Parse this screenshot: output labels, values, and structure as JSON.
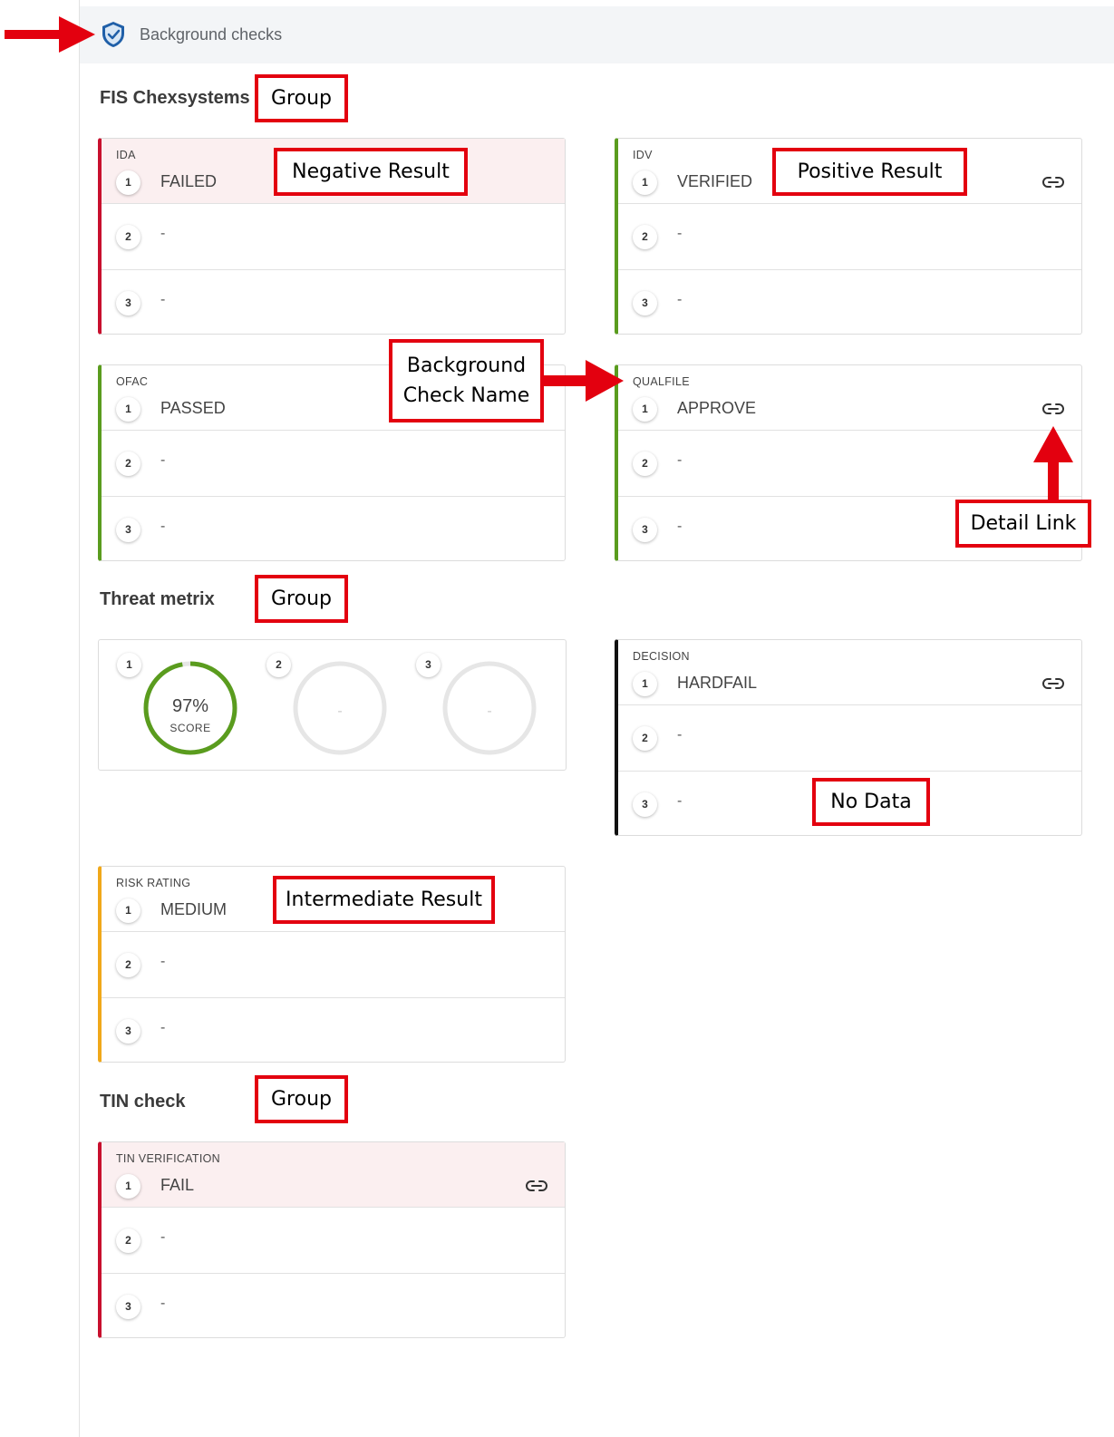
{
  "header": {
    "title": "Background checks"
  },
  "groups": {
    "fis": {
      "title": "FIS Chexsystems"
    },
    "threat": {
      "title": "Threat metrix"
    },
    "tin": {
      "title": "TIN check"
    }
  },
  "cards": {
    "ida": {
      "name": "IDA",
      "rows": [
        {
          "num": "1",
          "value": "FAILED"
        },
        {
          "num": "2",
          "value": "-"
        },
        {
          "num": "3",
          "value": "-"
        }
      ]
    },
    "idv": {
      "name": "IDV",
      "rows": [
        {
          "num": "1",
          "value": "VERIFIED"
        },
        {
          "num": "2",
          "value": "-"
        },
        {
          "num": "3",
          "value": "-"
        }
      ]
    },
    "ofac": {
      "name": "OFAC",
      "rows": [
        {
          "num": "1",
          "value": "PASSED"
        },
        {
          "num": "2",
          "value": "-"
        },
        {
          "num": "3",
          "value": "-"
        }
      ]
    },
    "qualfile": {
      "name": "QUALFILE",
      "rows": [
        {
          "num": "1",
          "value": "APPROVE"
        },
        {
          "num": "2",
          "value": "-"
        },
        {
          "num": "3",
          "value": "-"
        }
      ]
    },
    "decision": {
      "name": "DECISION",
      "rows": [
        {
          "num": "1",
          "value": "HARDFAIL"
        },
        {
          "num": "2",
          "value": "-"
        },
        {
          "num": "3",
          "value": "-"
        }
      ]
    },
    "risk": {
      "name": "RISK RATING",
      "rows": [
        {
          "num": "1",
          "value": "MEDIUM"
        },
        {
          "num": "2",
          "value": "-"
        },
        {
          "num": "3",
          "value": "-"
        }
      ]
    },
    "tin": {
      "name": "TIN VERIFICATION",
      "rows": [
        {
          "num": "1",
          "value": "FAIL"
        },
        {
          "num": "2",
          "value": "-"
        },
        {
          "num": "3",
          "value": "-"
        }
      ]
    }
  },
  "threat_scores": [
    {
      "num": "1",
      "value": "97%",
      "label": "SCORE",
      "fraction": 0.97
    },
    {
      "num": "2",
      "value": "-"
    },
    {
      "num": "3",
      "value": "-"
    }
  ],
  "annotations": {
    "group1": "Group",
    "group2": "Group",
    "group3": "Group",
    "negative": "Negative Result",
    "positive": "Positive Result",
    "check_name_line1": "Background",
    "check_name_line2": "Check Name",
    "detail_link": "Detail Link",
    "no_data": "No Data",
    "intermediate": "Intermediate Result"
  },
  "colors": {
    "negative": "#c8102e",
    "positive": "#5a9c1e",
    "intermediate": "#f0a81a",
    "neutral": "#111111",
    "annotation": "#e3000f",
    "shield": "#1f5fa8"
  }
}
